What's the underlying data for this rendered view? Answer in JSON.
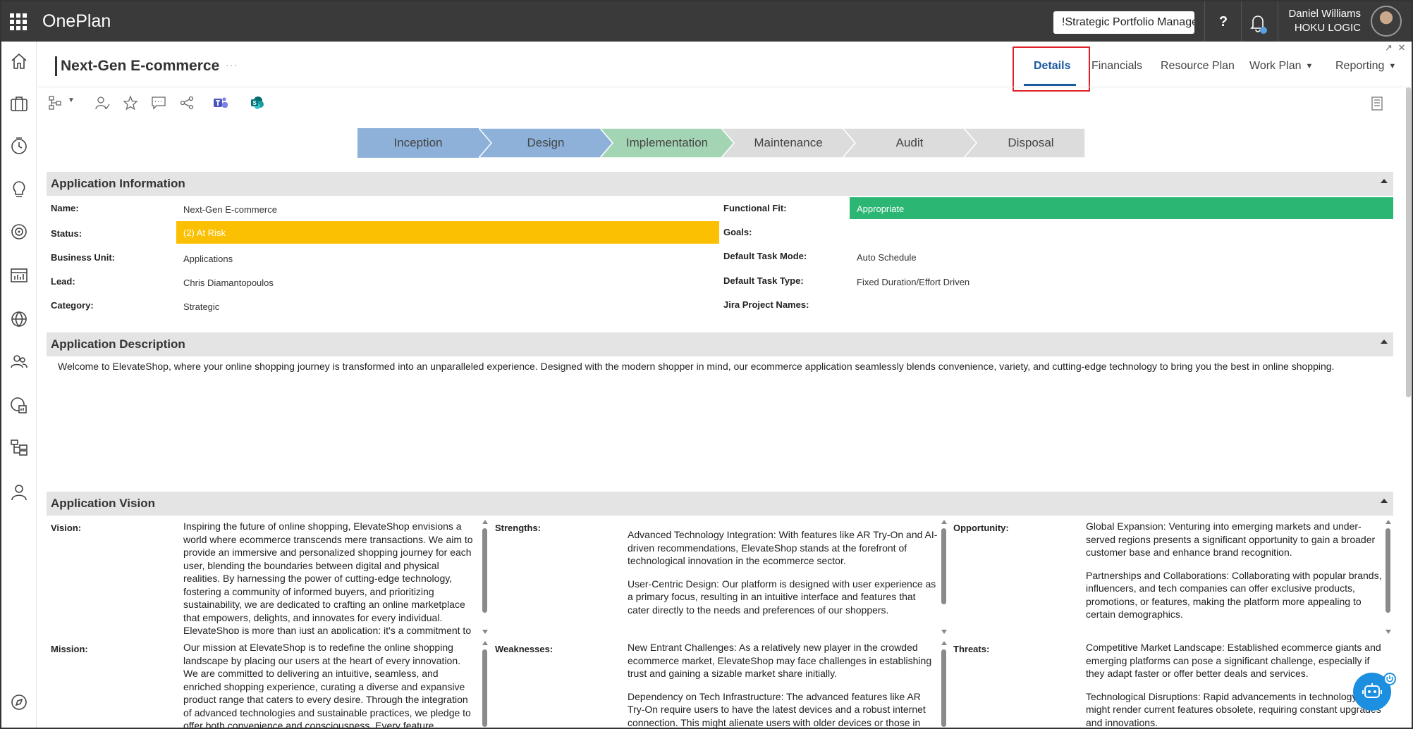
{
  "topbar": {
    "app_title": "OnePlan",
    "portfolio_label": "!Strategic Portfolio Manager",
    "help_label": "?",
    "user_name": "Daniel Williams",
    "user_org": "HOKU LOGIC"
  },
  "header": {
    "title": "Next-Gen E-commerce",
    "more_label": "···",
    "tabs": [
      {
        "label": "Details",
        "active": true
      },
      {
        "label": "Financials"
      },
      {
        "label": "Resource Plan"
      },
      {
        "label": "Work Plan"
      },
      {
        "label": "Reporting"
      }
    ]
  },
  "phases": [
    "Inception",
    "Design",
    "Implementation",
    "Maintenance",
    "Audit",
    "Disposal"
  ],
  "colors": {
    "phase_done": "#8db1d9",
    "phase_current": "#a3d5b4",
    "phase_future": "#dcdcdc",
    "status_at_risk": "#fbc002",
    "fit_appropriate": "#2bb673",
    "active_tab": "#1a5aa0"
  },
  "app_info": {
    "title": "Application Information",
    "left": [
      {
        "label": "Name:",
        "value": "Next-Gen E-commerce"
      },
      {
        "label": "Status:",
        "value": "(2) At Risk"
      },
      {
        "label": "Business Unit:",
        "value": "Applications"
      },
      {
        "label": "Lead:",
        "value": "Chris Diamantopoulos"
      },
      {
        "label": "Category:",
        "value": "Strategic"
      }
    ],
    "right": [
      {
        "label": "Functional Fit:",
        "value": "Appropriate"
      },
      {
        "label": "Goals:",
        "value": ""
      },
      {
        "label": "Default Task Mode:",
        "value": "Auto Schedule"
      },
      {
        "label": "Default Task Type:",
        "value": "Fixed Duration/Effort Driven"
      },
      {
        "label": "Jira Project Names:",
        "value": ""
      }
    ]
  },
  "app_desc": {
    "title": "Application Description",
    "text": "Welcome to ElevateShop, where your online shopping journey is transformed into an unparalleled experience. Designed with the modern shopper in mind, our ecommerce application seamlessly blends convenience, variety, and cutting-edge technology to bring you the best in online shopping."
  },
  "app_vision": {
    "title": "Application Vision",
    "vision_label": "Vision:",
    "vision_text": "Inspiring the future of online shopping, ElevateShop envisions a world where ecommerce transcends mere transactions. We aim to provide an immersive and personalized shopping journey for each user, blending the boundaries between digital and physical realities. By harnessing the power of cutting-edge technology, fostering a community of informed buyers, and prioritizing sustainability, we are dedicated to crafting an online marketplace that empowers, delights, and innovates for every individual. ElevateShop is more than just an application; it's a commitment to",
    "strengths_label": "Strengths:",
    "strengths_p1": "Advanced Technology Integration: With features like AR Try-On and AI-driven recommendations, ElevateShop stands at the forefront of technological innovation in the ecommerce sector.",
    "strengths_p2": "User-Centric Design: Our platform is designed with user experience as a primary focus, resulting in an intuitive interface and features that cater directly to the needs and preferences of our shoppers.",
    "opportunity_label": "Opportunity:",
    "opportunity_p1": "Global Expansion: Venturing into emerging markets and under-served regions presents a significant opportunity to gain a broader customer base and enhance brand recognition.",
    "opportunity_p2": "Partnerships and Collaborations: Collaborating with popular brands, influencers, and tech companies can offer exclusive products, promotions, or features, making the platform more appealing to certain demographics.",
    "mission_label": "Mission:",
    "mission_text": "Our mission at ElevateShop is to redefine the online shopping landscape by placing our users at the heart of every innovation. We are committed to delivering an intuitive, seamless, and enriched shopping experience, curating a diverse and expansive product range that caters to every desire. Through the integration of advanced technologies and sustainable practices, we pledge to offer both convenience and consciousness. Every feature,",
    "weaknesses_label": "Weaknesses:",
    "weaknesses_p1": "New Entrant Challenges: As a relatively new player in the crowded ecommerce market, ElevateShop may face challenges in establishing trust and gaining a sizable market share initially.",
    "weaknesses_p2": "Dependency on Tech Infrastructure: The advanced features like AR Try-On require users to have the latest devices and a robust internet connection. This might alienate users with older devices or those in",
    "threats_label": "Threats:",
    "threats_p1": "Competitive Market Landscape: Established ecommerce giants and emerging platforms can pose a significant challenge, especially if they adapt faster or offer better deals and services.",
    "threats_p2": "Technological Disruptions: Rapid advancements in technology might render current features obsolete, requiring constant upgrades and innovations."
  }
}
